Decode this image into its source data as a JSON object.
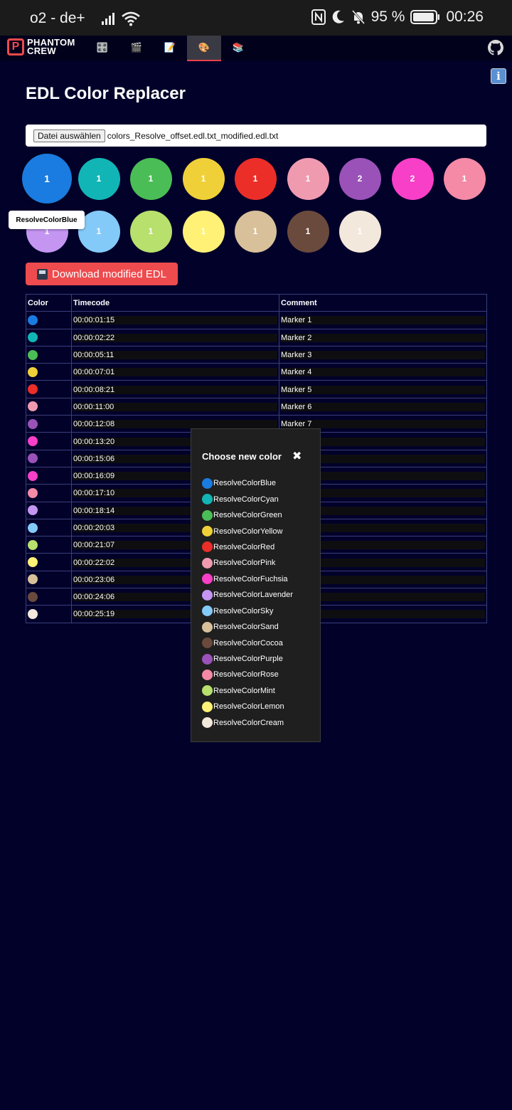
{
  "status_bar": {
    "carrier": "o2 - de+",
    "battery": "95 %",
    "time": "00:26"
  },
  "nav": {
    "logo_line1": "PHANTOM",
    "logo_line2": "CREW",
    "tabs": [
      {
        "icon": "🎛️",
        "name": "control-knobs-icon"
      },
      {
        "icon": "🎬",
        "name": "clapper-icon"
      },
      {
        "icon": "📝",
        "name": "memo-icon"
      },
      {
        "icon": "🎨",
        "name": "palette-icon",
        "active": true
      },
      {
        "icon": "📚",
        "name": "books-icon"
      }
    ],
    "info_glyph": "i"
  },
  "page": {
    "title": "EDL Color Replacer",
    "file_button": "Datei auswählen",
    "file_name": "colors_Resolve_offset.edl.txt_modified.edl.txt",
    "tooltip": "ResolveColorBlue",
    "download_label": "Download modified EDL"
  },
  "swatches": [
    {
      "color": "#1a7be0",
      "count": "1"
    },
    {
      "color": "#12b5b5",
      "count": "1"
    },
    {
      "color": "#4bbd56",
      "count": "1"
    },
    {
      "color": "#f0d038",
      "count": "1"
    },
    {
      "color": "#ec2e29",
      "count": "1"
    },
    {
      "color": "#f09ab0",
      "count": "1"
    },
    {
      "color": "#9a52b8",
      "count": "2"
    },
    {
      "color": "#f83fc8",
      "count": "2"
    },
    {
      "color": "#f48aa6",
      "count": "1"
    },
    {
      "color": "#c496f2",
      "count": "1"
    },
    {
      "color": "#84caf9",
      "count": "1"
    },
    {
      "color": "#b7e06c",
      "count": "1"
    },
    {
      "color": "#fff176",
      "count": "1"
    },
    {
      "color": "#d8c19a",
      "count": "1"
    },
    {
      "color": "#6a4a3c",
      "count": "1"
    },
    {
      "color": "#f3e8dc",
      "count": "1"
    }
  ],
  "table": {
    "headers": [
      "Color",
      "Timecode",
      "Comment"
    ],
    "rows": [
      {
        "color": "#1a7be0",
        "timecode": "00:00:01:15",
        "comment": "Marker 1"
      },
      {
        "color": "#12b5b5",
        "timecode": "00:00:02:22",
        "comment": "Marker 2"
      },
      {
        "color": "#4bbd56",
        "timecode": "00:00:05:11",
        "comment": "Marker 3"
      },
      {
        "color": "#f0d038",
        "timecode": "00:00:07:01",
        "comment": "Marker 4"
      },
      {
        "color": "#ec2e29",
        "timecode": "00:00:08:21",
        "comment": "Marker 5"
      },
      {
        "color": "#f09ab0",
        "timecode": "00:00:11:00",
        "comment": "Marker 6"
      },
      {
        "color": "#9a52b8",
        "timecode": "00:00:12:08",
        "comment": "Marker 7"
      },
      {
        "color": "#f83fc8",
        "timecode": "00:00:13:20",
        "comment": ""
      },
      {
        "color": "#9a52b8",
        "timecode": "00:00:15:06",
        "comment": ""
      },
      {
        "color": "#f83fc8",
        "timecode": "00:00:16:09",
        "comment": ""
      },
      {
        "color": "#f48aa6",
        "timecode": "00:00:17:10",
        "comment": ""
      },
      {
        "color": "#c496f2",
        "timecode": "00:00:18:14",
        "comment": ""
      },
      {
        "color": "#84caf9",
        "timecode": "00:00:20:03",
        "comment": ""
      },
      {
        "color": "#b7e06c",
        "timecode": "00:00:21:07",
        "comment": ""
      },
      {
        "color": "#fff176",
        "timecode": "00:00:22:02",
        "comment": ""
      },
      {
        "color": "#d8c19a",
        "timecode": "00:00:23:06",
        "comment": ""
      },
      {
        "color": "#6a4a3c",
        "timecode": "00:00:24:06",
        "comment": ""
      },
      {
        "color": "#f3e8dc",
        "timecode": "00:00:25:19",
        "comment": ""
      }
    ]
  },
  "popup": {
    "title": "Choose new color",
    "close_glyph": "✖",
    "options": [
      {
        "label": "ResolveColorBlue",
        "color": "#1a7be0"
      },
      {
        "label": "ResolveColorCyan",
        "color": "#12b5b5"
      },
      {
        "label": "ResolveColorGreen",
        "color": "#4bbd56"
      },
      {
        "label": "ResolveColorYellow",
        "color": "#f0d038"
      },
      {
        "label": "ResolveColorRed",
        "color": "#ec2e29"
      },
      {
        "label": "ResolveColorPink",
        "color": "#f09ab0"
      },
      {
        "label": "ResolveColorFuchsia",
        "color": "#f83fc8"
      },
      {
        "label": "ResolveColorLavender",
        "color": "#c496f2"
      },
      {
        "label": "ResolveColorSky",
        "color": "#84caf9"
      },
      {
        "label": "ResolveColorSand",
        "color": "#d8c19a"
      },
      {
        "label": "ResolveColorCocoa",
        "color": "#6a4a3c"
      },
      {
        "label": "ResolveColorPurple",
        "color": "#9a52b8"
      },
      {
        "label": "ResolveColorRose",
        "color": "#f48aa6"
      },
      {
        "label": "ResolveColorMint",
        "color": "#b7e06c"
      },
      {
        "label": "ResolveColorLemon",
        "color": "#fff176"
      },
      {
        "label": "ResolveColorCream",
        "color": "#f3e8dc"
      }
    ]
  }
}
